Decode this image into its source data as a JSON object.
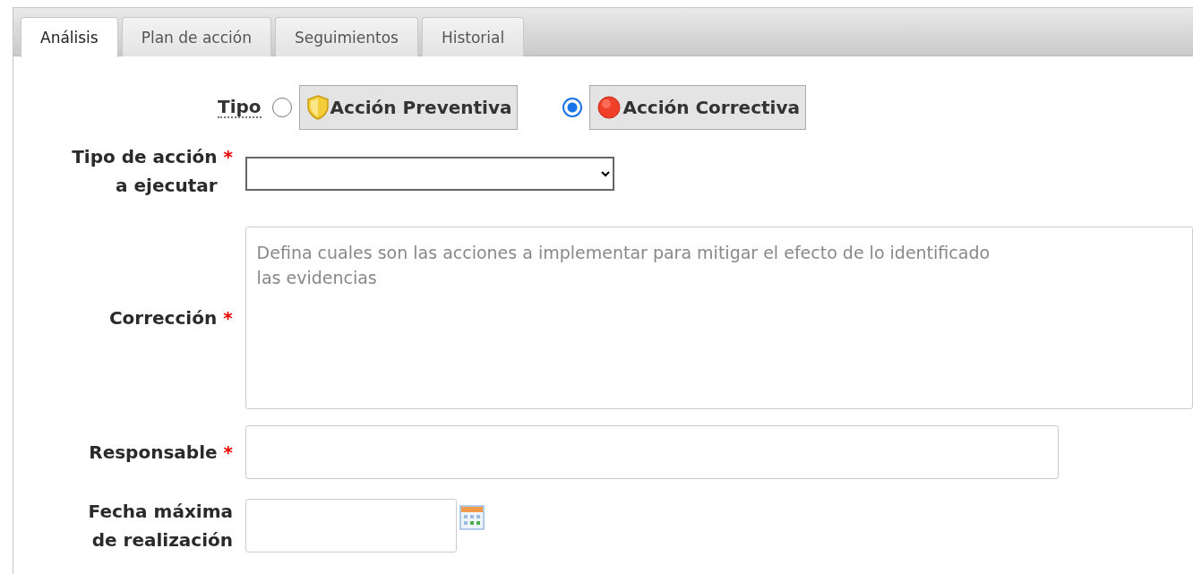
{
  "tabs": [
    {
      "label": "Análisis",
      "selected": true
    },
    {
      "label": "Plan de acción",
      "selected": false
    },
    {
      "label": "Seguimientos",
      "selected": false
    },
    {
      "label": "Historial",
      "selected": false
    }
  ],
  "tipo": {
    "label": "Tipo",
    "options": [
      {
        "kind": "shield",
        "label": "Acción Preventiva",
        "selected": false
      },
      {
        "kind": "stop",
        "label": "Acción Correctiva",
        "selected": true
      }
    ]
  },
  "fields": [
    {
      "kind": "select",
      "label": "Tipo de acción a ejecutar",
      "required_mark": "*"
    },
    {
      "kind": "textarea",
      "label": "Corrección",
      "required_mark": "*",
      "placeholder": "Defina cuales son las acciones a implementar para mitigar el efecto de lo identificado\nlas evidencias"
    },
    {
      "kind": "text",
      "label": "Responsable",
      "required_mark": "*"
    },
    {
      "kind": "date",
      "label": "Fecha máxima de realización"
    }
  ]
}
